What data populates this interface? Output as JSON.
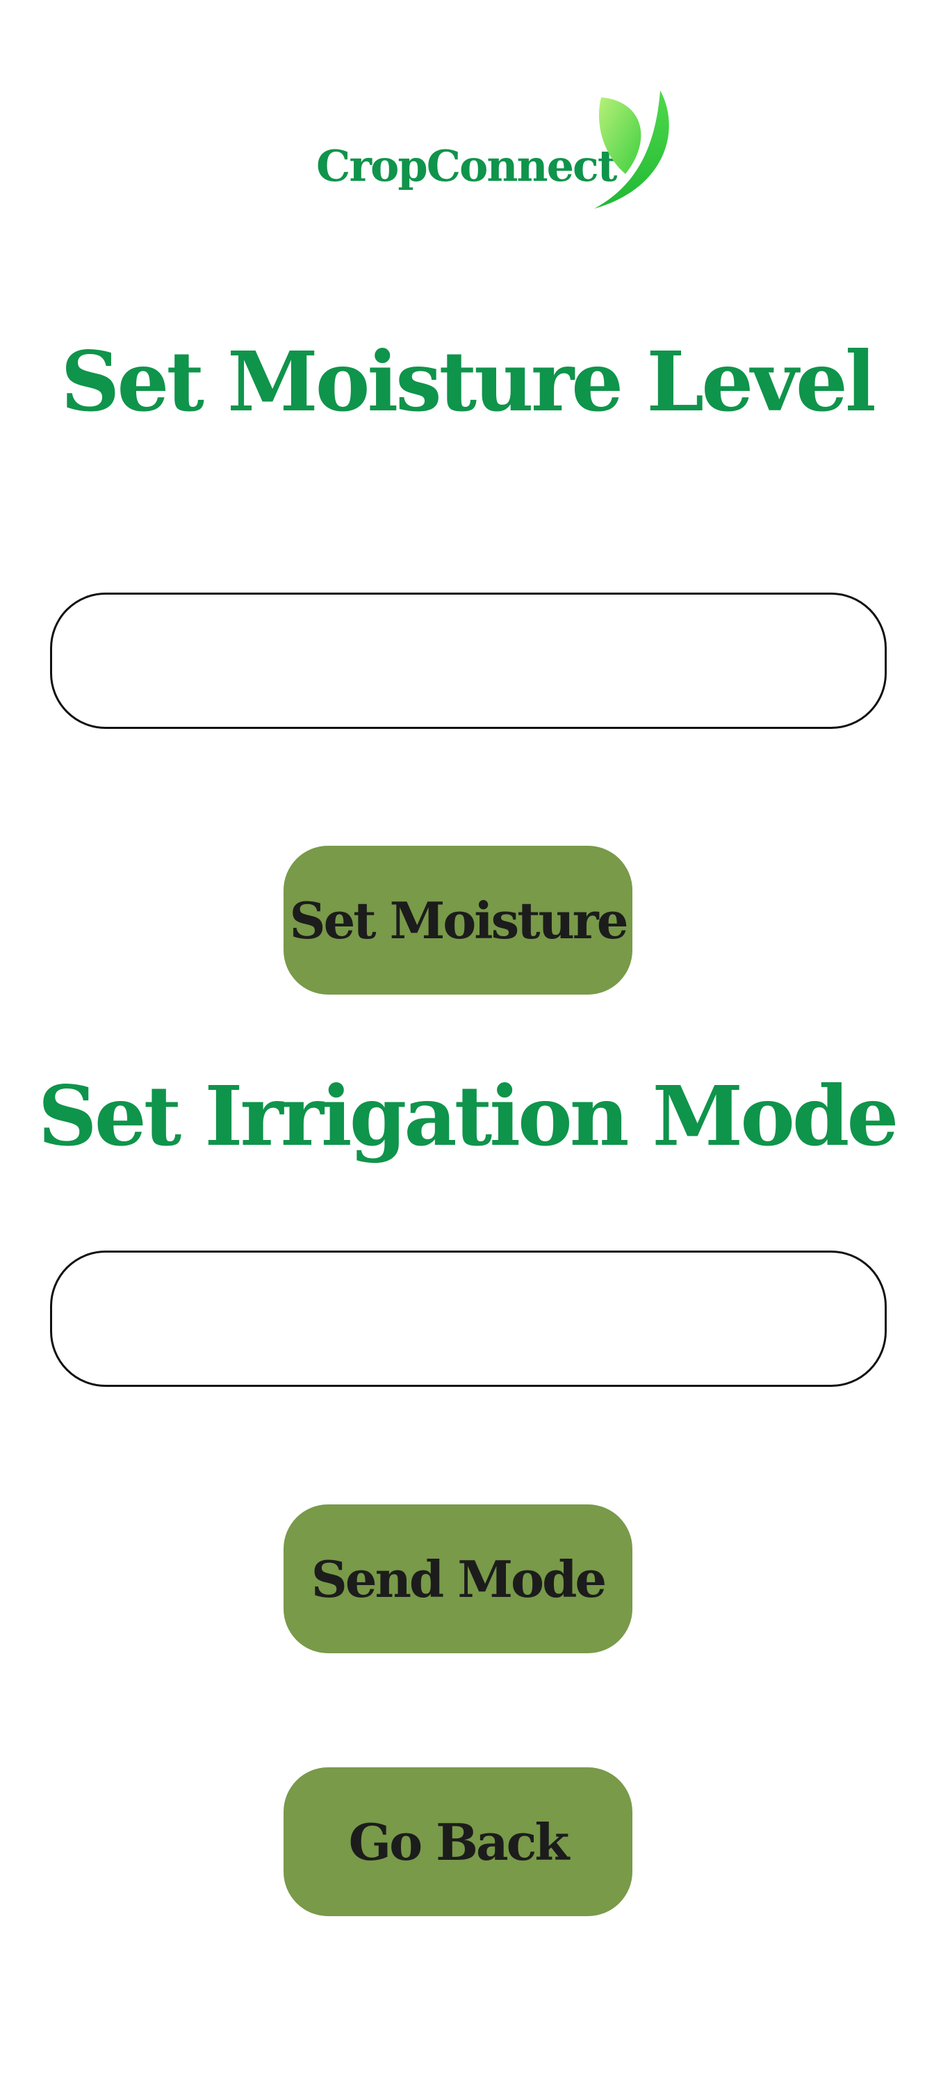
{
  "brand": {
    "name": "CropConnect",
    "logo_icon": "leaf-icon",
    "colors": {
      "brand_green": "#0f944b",
      "leaf_light": "#9ee85a",
      "leaf_dark": "#2bc63a",
      "button_bg": "#789a49",
      "button_text": "#1c1c1c"
    }
  },
  "moisture": {
    "heading": "Set Moisture Level",
    "input_value": "",
    "button_label": "Set Moisture"
  },
  "irrigation": {
    "heading": "Set Irrigation Mode",
    "input_value": "",
    "button_label": "Send Mode"
  },
  "navigation": {
    "back_label": "Go Back"
  }
}
